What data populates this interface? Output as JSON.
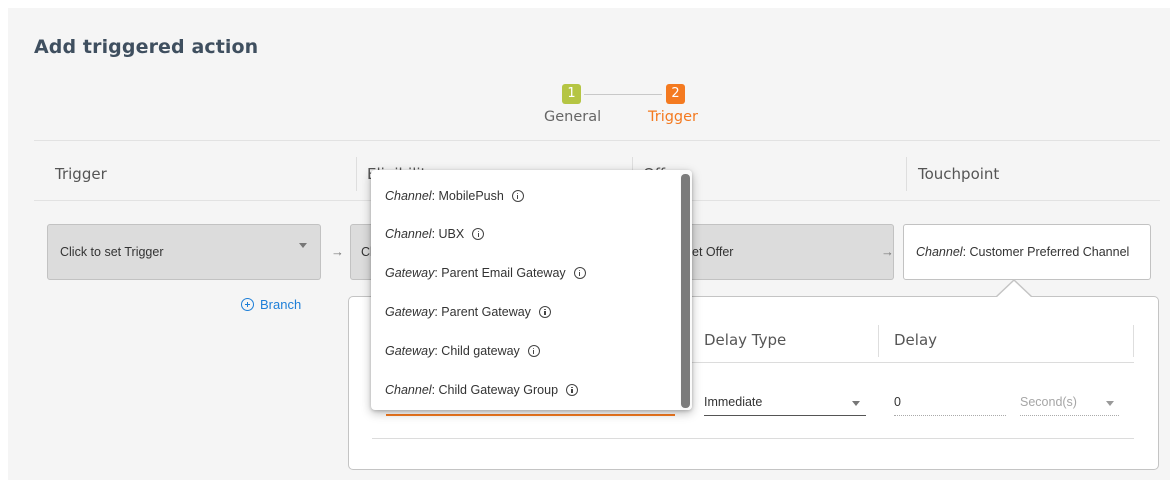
{
  "page": {
    "title": "Add triggered action"
  },
  "stepper": {
    "steps": [
      {
        "number": "1",
        "label": "General",
        "color": "#b5c543"
      },
      {
        "number": "2",
        "label": "Trigger",
        "color": "#f47a20"
      }
    ]
  },
  "columns": {
    "trigger": "Trigger",
    "eligibility": "Eligibility",
    "offer": "Offer",
    "touchpoint": "Touchpoint"
  },
  "flow": {
    "trigger_select": "Click to set Trigger",
    "eligibility_box": "Cl",
    "offer_box": "et Offer",
    "touchpoint_prefix": "Channel",
    "touchpoint_value": ": Customer Preferred Channel",
    "branch_label": "Branch"
  },
  "card": {
    "delay_type_header": "Delay Type",
    "delay_header": "Delay",
    "delay_type_value": "Immediate",
    "delay_value": "0",
    "delay_unit_placeholder": "Second(s)"
  },
  "dropdown": {
    "items": [
      {
        "type": "Channel",
        "name": ": MobilePush"
      },
      {
        "type": "Channel",
        "name": ": UBX"
      },
      {
        "type": "Gateway",
        "name": ": Parent Email Gateway"
      },
      {
        "type": "Gateway",
        "name": ": Parent Gateway"
      },
      {
        "type": "Gateway",
        "name": ": Child gateway"
      },
      {
        "type": "Channel",
        "name": ": Child Gateway Group"
      }
    ]
  },
  "colors": {
    "accent": "#f47a20",
    "step_complete": "#b5c543",
    "link": "#1e7fd8"
  }
}
